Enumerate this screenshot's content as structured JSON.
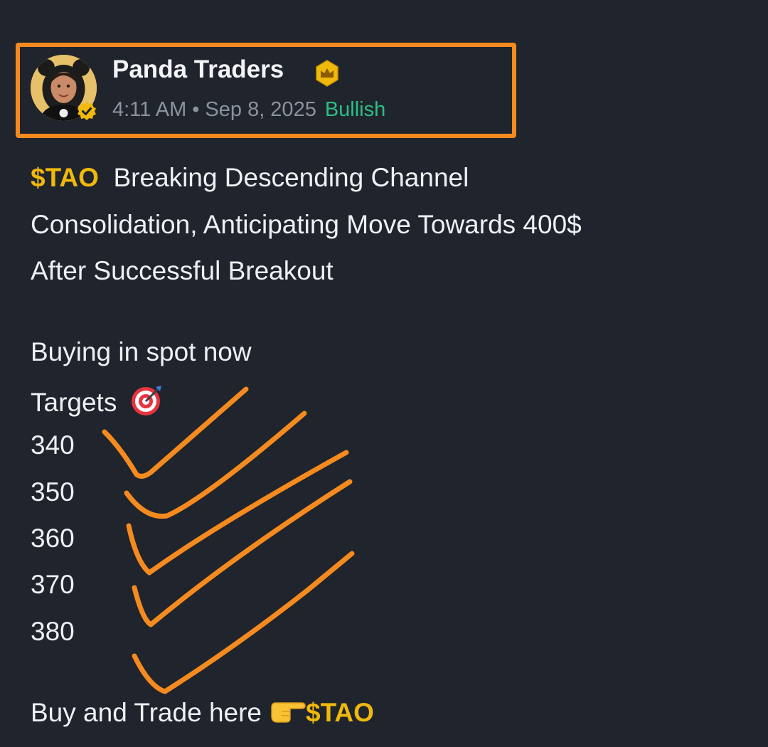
{
  "post_header": {
    "author_name": "Panda Traders",
    "time": "4:11 AM",
    "separator": "•",
    "date": "Sep 8, 2025",
    "sentiment": "Bullish"
  },
  "post_body": {
    "ticker": "$TAO",
    "headline_line1": "Breaking Descending Channel",
    "headline_line2": "Consolidation, Anticipating Move Towards 400$",
    "headline_line3": "After Successful Breakout",
    "buying_line": "Buying in spot now",
    "targets_label": "Targets",
    "targets": [
      "340",
      "350",
      "360",
      "370",
      "380"
    ],
    "cta_text": "Buy and Trade here",
    "cta_ticker": "$TAO"
  },
  "icons": {
    "avatar": "panda-hoodie-avatar",
    "verified": "verified-badge-icon",
    "crown": "crown-badge-icon",
    "targets_emoji": "dart-target-icon",
    "cta_emoji": "pointing-hand-icon",
    "annotation": "orange-checkmark-strokes"
  },
  "colors": {
    "background": "#20242d",
    "highlight_box": "#f58a1f",
    "ticker": "#f0b90b",
    "bullish": "#2ebd85",
    "meta_text": "#8c929e",
    "checkmarks": "#f58a1f"
  }
}
